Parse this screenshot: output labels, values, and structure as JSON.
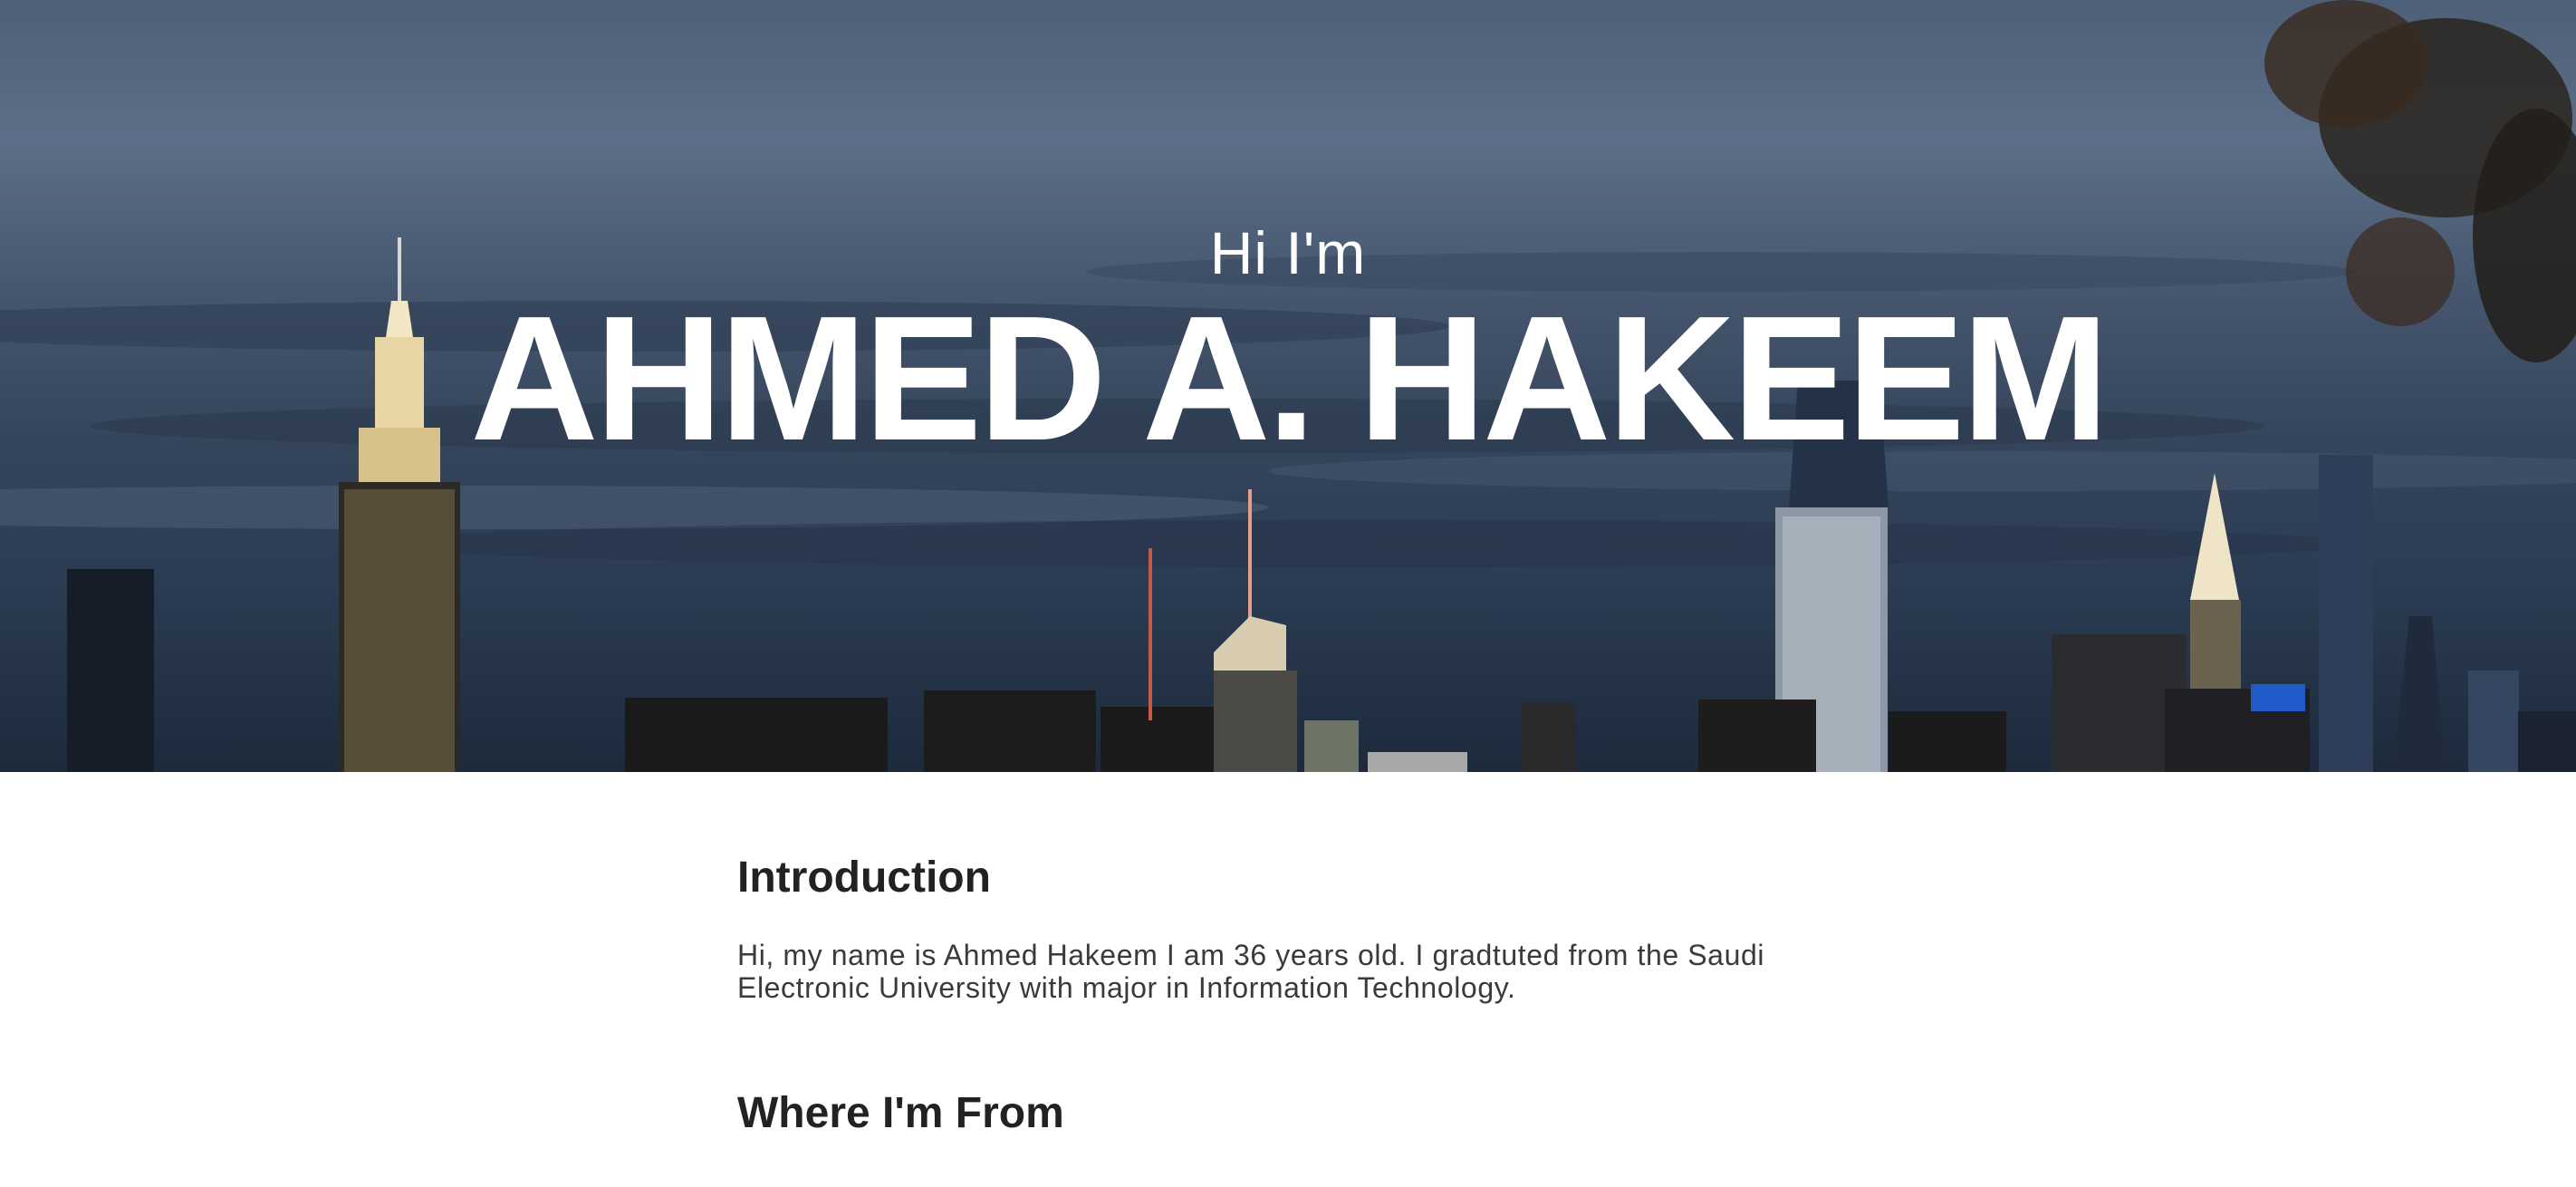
{
  "hero": {
    "greeting": "Hi I'm",
    "name": "AHMED A. HAKEEM",
    "background_description_icon": "city-skyline-night-image"
  },
  "sections": [
    {
      "title": "Introduction",
      "body": "Hi, my name is Ahmed Hakeem I am 36 years old. I gradtuted from the Saudi Electronic University with major in Information Technology."
    },
    {
      "title": "Where I'm From"
    }
  ],
  "colors": {
    "hero_text": "#ffffff",
    "heading": "#222222",
    "body_text": "#3a3a3a",
    "page_background": "#ffffff"
  }
}
